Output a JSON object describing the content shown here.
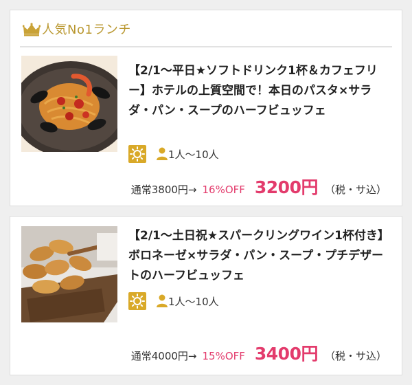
{
  "ranking": {
    "title": "人気No1ランチ",
    "icon": "crown-icon",
    "accent_color": "#b9972f"
  },
  "plans": [
    {
      "image": "pasta-with-mussels-photo",
      "title": "【2/1〜平日★ソフトドリンク1杯＆カフェフリー】ホテルの上質空間で！本日のパスタ×サラダ・パン・スープのハーフビュッフェ",
      "time_icon": "sun-icon",
      "capacity": "1人〜10人",
      "regular_price": "通常3800円→",
      "discount": "16%OFF",
      "price": "3200円",
      "tax": "（税・サ込）"
    },
    {
      "image": "bread-basket-photo",
      "title": "【2/1〜土日祝★スパークリングワイン1杯付き】ボロネーゼ×サラダ・パン・スープ・プチデザートのハーフビュッフェ",
      "time_icon": "sun-icon",
      "capacity": "1人〜10人",
      "regular_price": "通常4000円→",
      "discount": "15%OFF",
      "price": "3400円",
      "tax": "（税・サ込）"
    }
  ],
  "colors": {
    "price": "#e33b6c",
    "badge": "#d9a928",
    "background": "#efefef"
  }
}
